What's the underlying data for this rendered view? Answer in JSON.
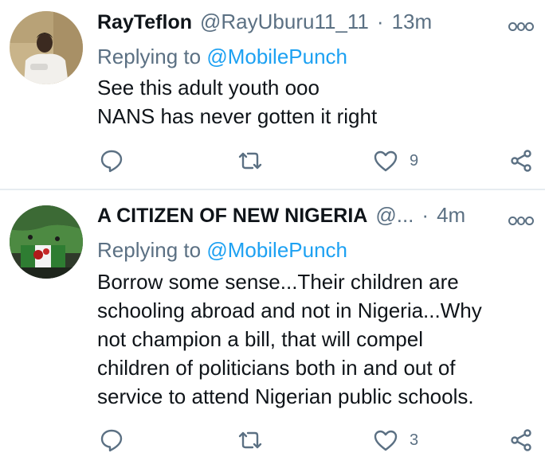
{
  "tweets": [
    {
      "name": "RayTeflon",
      "handle": "@RayUburu11_11",
      "separator": "·",
      "time": "13m",
      "replying_prefix": "Replying to",
      "replying_to": "@MobilePunch",
      "lines": [
        "See this adult youth ooo",
        "NANS has never gotten it right"
      ],
      "likes": "9"
    },
    {
      "name": "A CITIZEN OF NEW NIGERIA",
      "handle": "@...",
      "separator": "·",
      "time": "4m",
      "replying_prefix": "Replying to",
      "replying_to": "@MobilePunch",
      "lines": [
        "Borrow some sense...Their children are",
        "schooling abroad and not in Nigeria...Why",
        "not champion a bill, that will compel",
        "children of politicians both in and out of",
        "service to attend Nigerian public schools."
      ],
      "likes": "3"
    }
  ],
  "icons": {
    "reply": "reply-icon",
    "retweet": "retweet-icon",
    "like": "heart-icon",
    "share": "share-icon",
    "more": "more-options-icon"
  },
  "colors": {
    "link": "#1da1f2",
    "secondary_text": "#5b7083",
    "primary_text": "#0f1419",
    "divider": "#e6ecf0"
  }
}
